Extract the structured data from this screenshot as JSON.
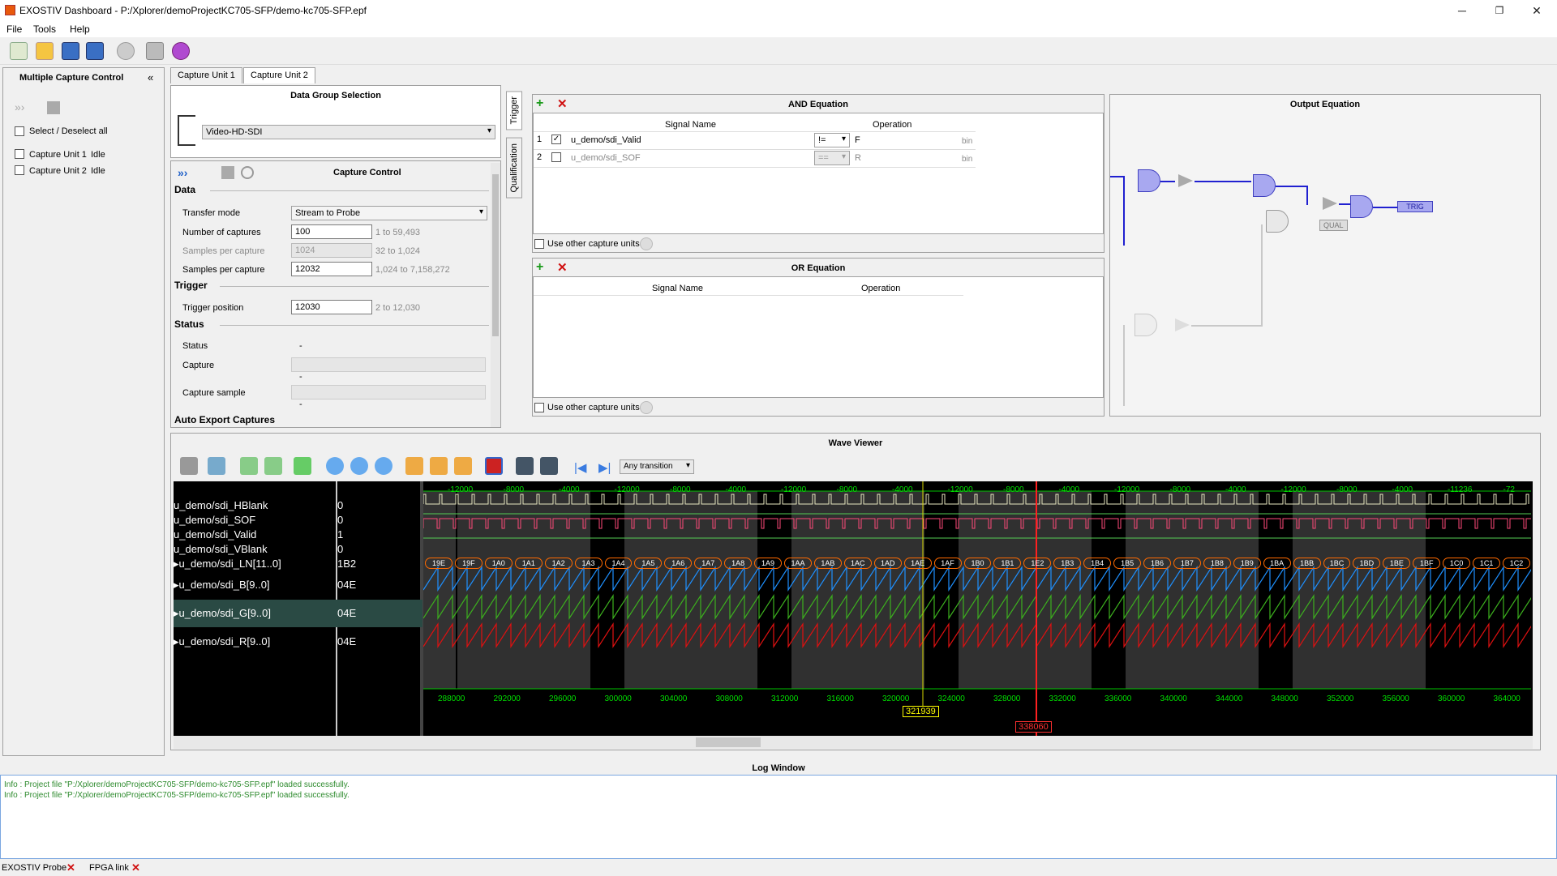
{
  "window": {
    "title": "EXOSTIV Dashboard - P:/Xplorer/demoProjectKC705-SFP/demo-kc705-SFP.epf",
    "minimize": "─",
    "restore": "❐",
    "close": "✕"
  },
  "menu": [
    "File",
    "Tools",
    "Help"
  ],
  "toolbar_icons": [
    "new-project-icon",
    "open-project-icon",
    "save-icon",
    "save-as-icon",
    "link-icon",
    "tools-icon",
    "bug-icon"
  ],
  "left_panel": {
    "title": "Multiple Capture Control",
    "collapse": "«",
    "select_all": "Select / Deselect all",
    "units": [
      {
        "name": "Capture Unit 1",
        "state": "Idle"
      },
      {
        "name": "Capture Unit 2",
        "state": "Idle"
      }
    ]
  },
  "tabs": [
    "Capture Unit 1",
    "Capture Unit 2"
  ],
  "data_group": {
    "title": "Data Group Selection",
    "selected": "Video-HD-SDI"
  },
  "capture_control": {
    "title": "Capture Control",
    "data_section": "Data",
    "transfer_mode_label": "Transfer mode",
    "transfer_mode": "Stream to Probe",
    "num_captures_label": "Number of captures",
    "num_captures": "100",
    "num_captures_range": "1  to  59,493",
    "samples_per_capture_label": "Samples per capture",
    "samples_per_capture": "1024",
    "samples_per_capture_range": "32  to  1,024",
    "samples_per_capture2_label": "Samples per capture",
    "samples_per_capture2": "12032",
    "samples_per_capture2_range": "1,024  to  7,158,272",
    "trigger_section": "Trigger",
    "trigger_position_label": "Trigger position",
    "trigger_position": "12030",
    "trigger_position_range": "2  to  12,030",
    "status_section": "Status",
    "status_label": "Status",
    "status_value": "-",
    "capture_label": "Capture",
    "capture_value": "-",
    "capture_sample_label": "Capture sample",
    "capture_sample_value": "-",
    "auto_export": "Auto Export Captures"
  },
  "side_tabs": [
    "Trigger",
    "Qualification"
  ],
  "and_equation": {
    "title": "AND Equation",
    "col_signal": "Signal Name",
    "col_operation": "Operation",
    "rows": [
      {
        "idx": "1",
        "checked": "✓",
        "signal": "u_demo/sdi_Valid",
        "op": "!=",
        "value": "F",
        "fmt": "bin"
      },
      {
        "idx": "2",
        "checked": "",
        "signal": "u_demo/sdi_SOF",
        "op": "==",
        "value": "R",
        "fmt": "bin"
      }
    ],
    "use_other": "Use other capture units"
  },
  "or_equation": {
    "title": "OR Equation",
    "col_signal": "Signal Name",
    "col_operation": "Operation",
    "use_other": "Use other capture units"
  },
  "output_equation": {
    "title": "Output Equation",
    "qual": "QUAL",
    "trig": "TRIG"
  },
  "wave_viewer": {
    "title": "Wave Viewer",
    "transition": "Any transition",
    "signals": [
      {
        "name": "u_demo/sdi_HBlank",
        "value": "0"
      },
      {
        "name": "u_demo/sdi_SOF",
        "value": "0"
      },
      {
        "name": "u_demo/sdi_Valid",
        "value": "1"
      },
      {
        "name": "u_demo/sdi_VBlank",
        "value": "0"
      },
      {
        "name": "▸u_demo/sdi_LN[11..0]",
        "value": "1B2"
      },
      {
        "name": "▸u_demo/sdi_B[9..0]",
        "value": "04E"
      },
      {
        "name": "▸u_demo/sdi_G[9..0]",
        "value": "04E"
      },
      {
        "name": "▸u_demo/sdi_R[9..0]",
        "value": "04E"
      }
    ],
    "top_ticks": [
      "-12000",
      "-8000",
      "-4000",
      "-12000",
      "-8000",
      "-4000",
      "-12000",
      "-8000",
      "-4000",
      "-12000",
      "-8000",
      "-4000",
      "-12000",
      "-8000",
      "-4000",
      "-12000",
      "-8000",
      "-4000",
      "-11236",
      "-72"
    ],
    "bottom_ticks": [
      "288000",
      "292000",
      "296000",
      "300000",
      "304000",
      "308000",
      "312000",
      "316000",
      "320000",
      "324000",
      "328000",
      "332000",
      "336000",
      "340000",
      "344000",
      "348000",
      "352000",
      "356000",
      "360000",
      "364000"
    ],
    "bus_values": [
      "19E",
      "19F",
      "1A0",
      "1A1",
      "1A2",
      "1A3",
      "1A4",
      "1A5",
      "1A6",
      "1A7",
      "1A8",
      "1A9",
      "1AA",
      "1AB",
      "1AC",
      "1AD",
      "1AE",
      "1AF",
      "1B0",
      "1B1",
      "1E2",
      "1B3",
      "1B4",
      "1B5",
      "1B6",
      "1B7",
      "1B8",
      "1B9",
      "1BA",
      "1BB",
      "1BC",
      "1BD",
      "1BE",
      "1BF",
      "1C0",
      "1C1",
      "1C2"
    ],
    "cursor1": "321939",
    "cursor2": "338060"
  },
  "log": {
    "title": "Log Window",
    "lines": [
      "Info : Project file \"P:/Xplorer/demoProjectKC705-SFP/demo-kc705-SFP.epf\" loaded successfully.",
      "Info : Project file \"P:/Xplorer/demoProjectKC705-SFP/demo-kc705-SFP.epf\" loaded successfully."
    ]
  },
  "status_bar": [
    "EXOSTIV Probe",
    "FPGA link"
  ],
  "colors": {
    "blue": "#1e90ff",
    "green": "#3cb01e",
    "red": "#e01010",
    "bus": "#ff6a00",
    "log_text": "#2e8b2e"
  }
}
